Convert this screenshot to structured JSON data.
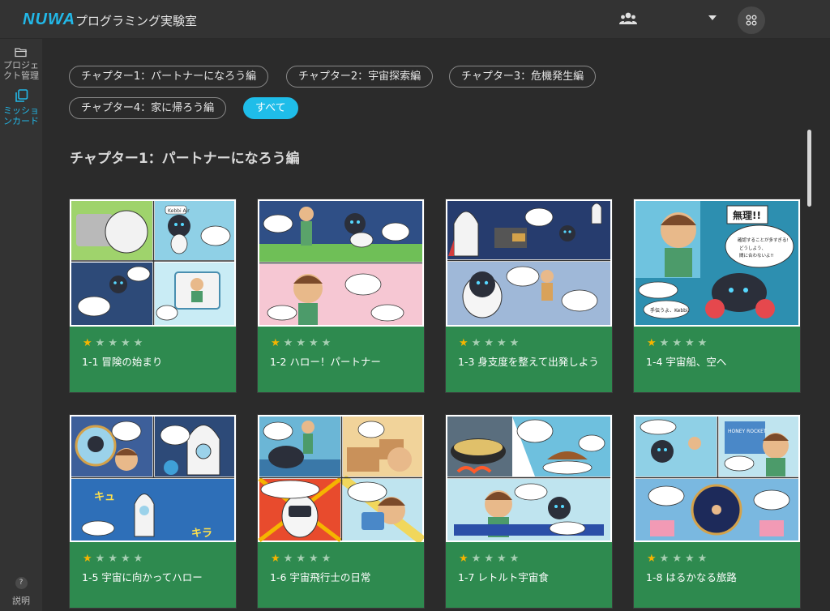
{
  "header": {
    "logo": "NUWA",
    "title": "プログラミング実験室",
    "users_icon": "users-icon",
    "dropdown_icon": "caret-down-icon",
    "apps_icon": "grid-icon"
  },
  "sidebar": {
    "items": [
      {
        "label_line1": "プロジェ",
        "label_line2": "クト管理",
        "icon": "folder-icon",
        "active": false
      },
      {
        "label_line1": "ミッショ",
        "label_line2": "ンカード",
        "icon": "cards-icon",
        "active": true
      }
    ],
    "help": {
      "glyph": "?",
      "label": "説明"
    }
  },
  "filters": [
    {
      "label": "チャプター1：パートナーになろう編",
      "selected": false
    },
    {
      "label": "チャプター2：宇宙探索編",
      "selected": false
    },
    {
      "label": "チャプター3：危機発生編",
      "selected": false
    },
    {
      "label": "チャプター4：家に帰ろう編",
      "selected": false
    },
    {
      "label": "すべて",
      "selected": true
    }
  ],
  "section": {
    "title": "チャプター1：パートナーになろう編"
  },
  "cards": [
    {
      "title": "1-1 冒険の始まり",
      "rating": 1,
      "max_rating": 5
    },
    {
      "title": "1-2 ハロー！パートナー",
      "rating": 1,
      "max_rating": 5
    },
    {
      "title": "1-3 身支度を整えて出発しよう",
      "rating": 1,
      "max_rating": 5
    },
    {
      "title": "1-4 宇宙船、空へ",
      "rating": 1,
      "max_rating": 5
    },
    {
      "title": "1-5 宇宙に向かってハロー",
      "rating": 1,
      "max_rating": 5
    },
    {
      "title": "1-6 宇宙飛行士の日常",
      "rating": 1,
      "max_rating": 5
    },
    {
      "title": "1-7 レトルト宇宙食",
      "rating": 1,
      "max_rating": 5
    },
    {
      "title": "1-8 はるかなる旅路",
      "rating": 1,
      "max_rating": 5
    }
  ],
  "comic_text": {
    "c1_label": "Kebbi Air",
    "c4_shout": "無理!!",
    "c4_bubble": "確認することが多すぎる! どうしよう、間に合わないよ!!",
    "c4_speech": "手伝うよ、Kebbi!",
    "c5_sfx1": "キュ",
    "c5_sfx2": "キラ",
    "c8_sign": "HONEY ROCKET"
  },
  "colors": {
    "accent": "#1fbde9",
    "card_green": "#2e8a4f",
    "star_filled": "#f5b400",
    "star_empty": "#a7cfb3"
  }
}
